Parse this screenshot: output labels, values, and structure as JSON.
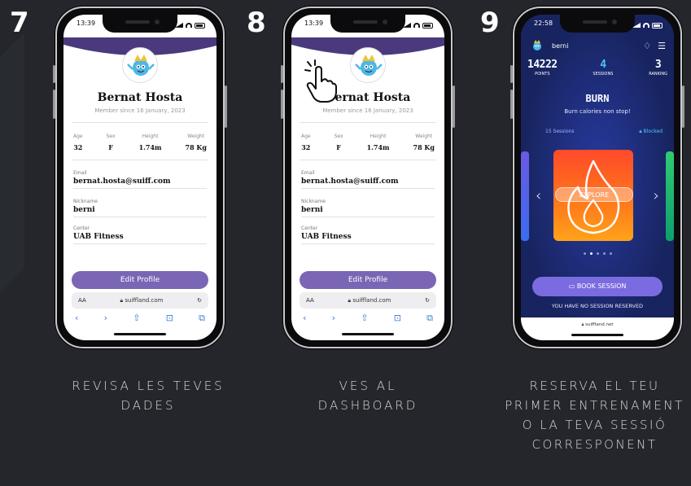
{
  "steps": [
    {
      "number": "7",
      "caption": "REVISA LES TEVES DADES",
      "screen": {
        "time": "13:39",
        "name": "Bernat Hosta",
        "member_since": "Member since 16 January, 2023",
        "stats": [
          {
            "label": "Age",
            "value": "32"
          },
          {
            "label": "Sex",
            "value": "F"
          },
          {
            "label": "Height",
            "value": "1.74m"
          },
          {
            "label": "Weight",
            "value": "78 Kg"
          }
        ],
        "fields": [
          {
            "label": "Email",
            "value": "bernat.hosta@suiff.com"
          },
          {
            "label": "Nickname",
            "value": "berni"
          },
          {
            "label": "Center",
            "value": "UAB Fitness"
          }
        ],
        "edit_button": "Edit Profile",
        "browser": {
          "aa": "AA",
          "url": "suiffland.com",
          "reload": "↻"
        }
      }
    },
    {
      "number": "8",
      "caption": "VES AL DASHBOARD",
      "screen": {
        "time": "13:39",
        "name": "Bernat Hosta",
        "member_since": "Member since 16 January, 2023",
        "stats": [
          {
            "label": "Age",
            "value": "32"
          },
          {
            "label": "Sex",
            "value": "F"
          },
          {
            "label": "Height",
            "value": "1.74m"
          },
          {
            "label": "Weight",
            "value": "78 Kg"
          }
        ],
        "fields": [
          {
            "label": "Email",
            "value": "bernat.hosta@suiff.com"
          },
          {
            "label": "Nickname",
            "value": "berni"
          },
          {
            "label": "Center",
            "value": "UAB Fitness"
          }
        ],
        "edit_button": "Edit Profile",
        "browser": {
          "aa": "AA",
          "url": "suiffland.com",
          "reload": "↻"
        }
      }
    },
    {
      "number": "9",
      "caption": "RESERVA EL TEU PRIMER ENTRENAMENT O LA TEVA SESSIÓ CORRESPONENT",
      "screen": {
        "time": "22:58",
        "username": "berni",
        "stats": [
          {
            "value": "14222",
            "label": "POINTS"
          },
          {
            "value": "4",
            "label": "SESSIONS"
          },
          {
            "value": "3",
            "label": "RANKING"
          }
        ],
        "activity_title": "BURN",
        "activity_desc": "Burn calories non stop!",
        "sessions_count": "15 Sessions",
        "blocked_label": "Blocked",
        "explore_button": "EXPLORE",
        "book_button": "BOOK SESSION",
        "no_session": "YOU HAVE NO SESSION RESERVED",
        "url": "suiffland.net"
      }
    }
  ],
  "colors": {
    "background": "#24262b",
    "brand_purple": "#4a3a7d",
    "button_purple": "#7b66b5",
    "dash_blue": "#1f2f82",
    "accent_cyan": "#4fc3ff",
    "card_orange": "#ff5a24"
  }
}
